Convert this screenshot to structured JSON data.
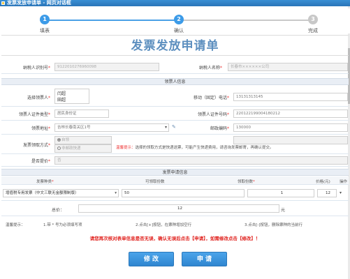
{
  "window": {
    "title": "发票发放申请单 - 网页对话框"
  },
  "steps": [
    {
      "num": "1",
      "label": "填表",
      "state": "done"
    },
    {
      "num": "2",
      "label": "确认",
      "state": "active"
    },
    {
      "num": "3",
      "label": "完成",
      "state": "pending"
    }
  ],
  "form": {
    "title": "发票发放申请单",
    "taxpayer_id_label": "纳税人识别号",
    "taxpayer_id_value": "9122010276960098",
    "taxpayer_name_label": "纳税人名称",
    "taxpayer_name_value": "长春市××××××公司"
  },
  "recipient": {
    "section_title": "领票人信息",
    "name_label": "选择领票人",
    "name_options": [
      "闫超",
      "田超"
    ],
    "phone_label": "移动（固定）电话",
    "phone_value": "13131313145",
    "id_type_label": "领票人证件类型",
    "id_type_value": "居民身份证",
    "id_number_label": "领票人证件号码",
    "id_number_value": "220122199004180212",
    "address_label": "领票地址",
    "address_value": "吉林长春南关区1号",
    "postcode_label": "邮政编码",
    "postcode_value": "130000",
    "method_label": "发票领取方式",
    "method_value1": "自领",
    "method_value2": "非邮政快递",
    "method_hint_prefix": "温馨提示：",
    "method_hint_text": "选择的领取方式是快递送票，可能产生快递费用，请咨询发票邮寄，再确认提交。",
    "urgent_label": "是否提价",
    "urgent_value": "否"
  },
  "invoice": {
    "section_title": "发票申请信息",
    "col_type": "发票种类",
    "col_available": "可领取份数",
    "col_requested": "领取份数",
    "col_price": "价格(元)",
    "col_action": "操作",
    "row_type": "增值税专用发票（中文三联无金额限制版）",
    "row_available": "50",
    "row_requested": "1",
    "row_price": "12",
    "total_label": "总价：",
    "total_value": "12",
    "total_unit": "元"
  },
  "tips": {
    "prefix": "温馨提示：",
    "t1": "1.带 * 号为必须填写项",
    "t2": "2.点击[+]按钮，在票种增加空行",
    "t3": "3.点击[-]按钮，删除票种的当前行"
  },
  "warning": "请您再次核对表单信息是否无误，确认无误后点击【申请】，如需修改点击【修改】！",
  "buttons": {
    "modify": "修 改",
    "apply": "申 请"
  }
}
